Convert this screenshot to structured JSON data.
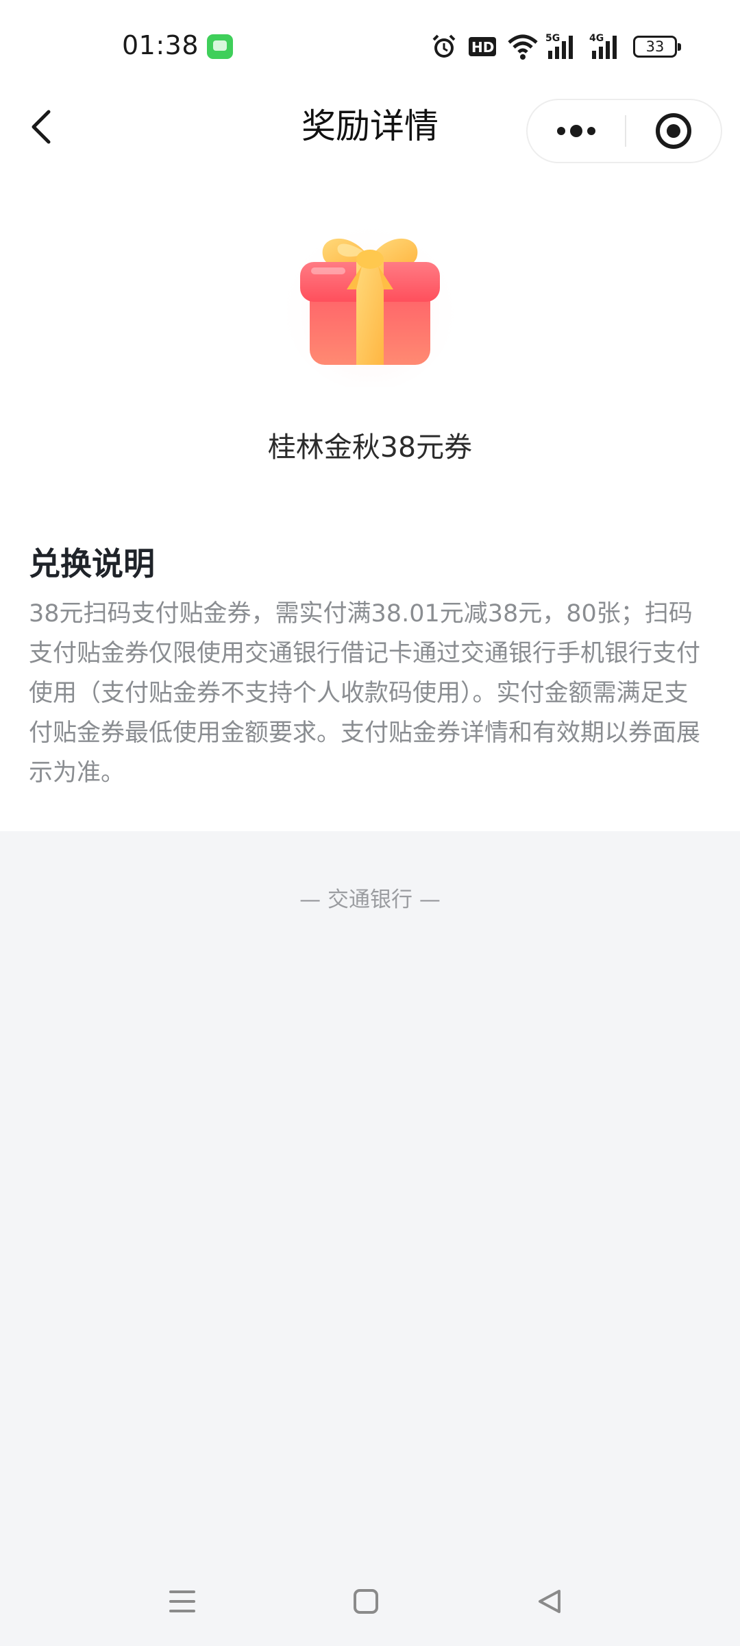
{
  "status_bar": {
    "time": "01:38",
    "battery_level": "33",
    "icons": [
      "message-app-icon",
      "alarm-icon",
      "hd-icon",
      "wifi-icon",
      "signal-5g-icon",
      "signal-4g-icon",
      "battery-icon"
    ]
  },
  "nav": {
    "title": "奖励详情",
    "back_icon": "chevron-left-icon",
    "more_icon": "more-dots-icon",
    "close_icon": "target-close-icon"
  },
  "reward": {
    "icon": "gift-box-icon",
    "name": "桂林金秋38元券"
  },
  "redeem": {
    "title": "兑换说明",
    "description": "38元扫码支付贴金券，需实付满38.01元减38元，80张；扫码支付贴金券仅限使用交通银行借记卡通过交通银行手机银行支付使用（支付贴金券不支持个人收款码使用）。实付金额需满足支付贴金券最低使用金额要求。支付贴金券详情和有效期以券面展示为准。"
  },
  "footer": {
    "brand": "— 交通银行 —"
  },
  "system_nav": {
    "icons": [
      "menu-icon",
      "home-square-icon",
      "back-triangle-icon"
    ]
  },
  "colors": {
    "background": "#f4f5f7",
    "card": "#ffffff",
    "gift_red": "#ff5a5f",
    "gift_ribbon": "#ffc85a",
    "muted_text": "#8a8d91"
  }
}
